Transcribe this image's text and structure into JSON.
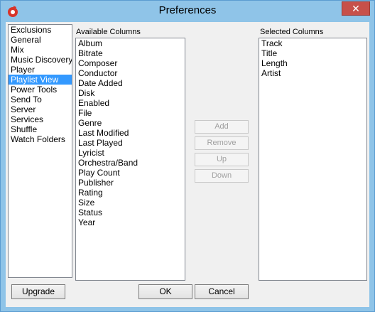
{
  "window": {
    "title": "Preferences",
    "close_glyph": "✕"
  },
  "categories": {
    "items": [
      {
        "label": "Exclusions",
        "selected": false
      },
      {
        "label": "General",
        "selected": false
      },
      {
        "label": "Mix",
        "selected": false
      },
      {
        "label": "Music Discovery",
        "selected": false
      },
      {
        "label": "Player",
        "selected": false
      },
      {
        "label": "Playlist View",
        "selected": true
      },
      {
        "label": "Power Tools",
        "selected": false
      },
      {
        "label": "Send To",
        "selected": false
      },
      {
        "label": "Server",
        "selected": false
      },
      {
        "label": "Services",
        "selected": false
      },
      {
        "label": "Shuffle",
        "selected": false
      },
      {
        "label": "Watch Folders",
        "selected": false
      }
    ]
  },
  "available": {
    "label": "Available Columns",
    "items": [
      "Album",
      "Bitrate",
      "Composer",
      "Conductor",
      "Date Added",
      "Disk",
      "Enabled",
      "File",
      "Genre",
      "Last Modified",
      "Last Played",
      "Lyricist",
      "Orchestra/Band",
      "Play Count",
      "Publisher",
      "Rating",
      "Size",
      "Status",
      "Year"
    ]
  },
  "selected": {
    "label": "Selected Columns",
    "items": [
      "Track",
      "Title",
      "Length",
      "Artist"
    ]
  },
  "actions": {
    "add": "Add",
    "remove": "Remove",
    "up": "Up",
    "down": "Down"
  },
  "footer": {
    "upgrade": "Upgrade",
    "ok": "OK",
    "cancel": "Cancel"
  },
  "colors": {
    "titlebar": "#8fc4e8",
    "selection": "#3399ff",
    "close": "#c7504a"
  }
}
